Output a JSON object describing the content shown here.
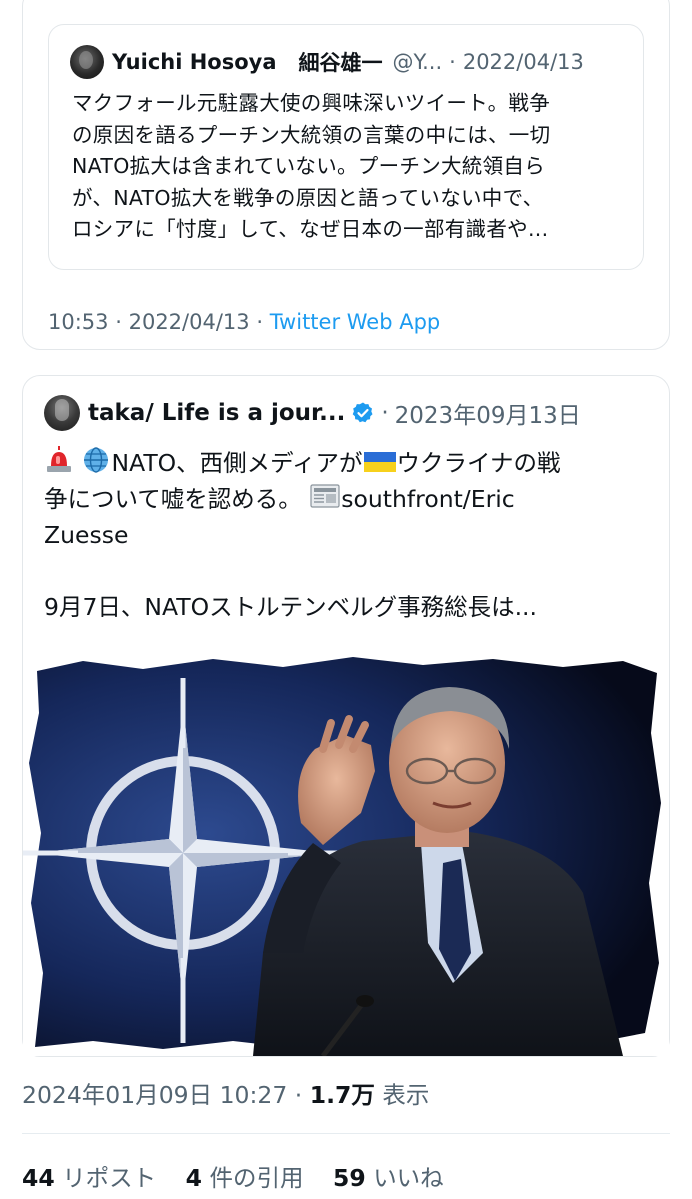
{
  "quoted1": {
    "name": "Yuichi Hosoya",
    "jp_name": "細谷雄一",
    "handle": "@Y...",
    "dot": "·",
    "date": "2022/04/13",
    "lines": [
      "マクフォール元駐露大使の興味深いツイート。戦争",
      "の原因を語るプーチン大統領の言葉の中には、一切",
      "NATO拡大は含まれていない。プーチン大統領自ら",
      "が、NATO拡大を戦争の原因と語っていない中で、",
      "ロシアに「忖度」して、なぜ日本の一部有識者や..."
    ]
  },
  "tweet1_meta": {
    "time": "10:53",
    "sep": "·",
    "date": "2022/04/13",
    "app": "Twitter Web App"
  },
  "quoted2": {
    "name": "taka/ Life is a jour...",
    "dot": "·",
    "date": "2023年09月13日",
    "line1": "NATO、西側メディアが",
    "line1b": "ウクライナの戦",
    "line2": "争について嘘を認める。",
    "line2b": "southfront/Eric",
    "line3": "Zuesse",
    "line4": "9月7日、NATOストルテンベルグ事務総長は...",
    "emoji": [
      "rotating-light-icon",
      "globe-icon",
      "ukraine-flag-icon",
      "newspaper-icon"
    ]
  },
  "tweet2_meta": {
    "datetime": "2024年01月09日 10:27",
    "sep": "·",
    "views_count": "1.7万",
    "views_label": "表示"
  },
  "stats": {
    "reposts_count": "44",
    "reposts_label": "リポスト",
    "quotes_count": "4",
    "quotes_label": "件の引用",
    "likes_count": "59",
    "likes_label": "いいね"
  },
  "colors": {
    "secondary_text": "#536471",
    "link": "#1d9bf0",
    "border": "#e3e7ea",
    "verified": "#1d9bf0"
  }
}
